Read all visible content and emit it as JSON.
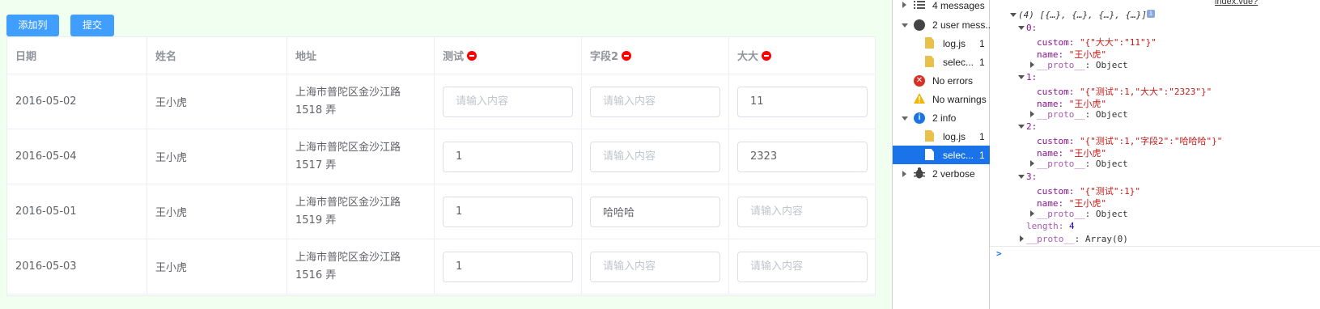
{
  "toolbar": {
    "add_column_label": "添加列",
    "submit_label": "提交"
  },
  "table": {
    "headers": {
      "date": "日期",
      "name": "姓名",
      "address": "地址",
      "col1": "测试",
      "col2": "字段2",
      "col3": "大大"
    },
    "placeholder": "请输入内容",
    "rows": [
      {
        "date": "2016-05-02",
        "name": "王小虎",
        "address": "上海市普陀区金沙江路 1518 弄",
        "col1": "",
        "col2": "",
        "col3": "11"
      },
      {
        "date": "2016-05-04",
        "name": "王小虎",
        "address": "上海市普陀区金沙江路 1517 弄",
        "col1": "1",
        "col2": "",
        "col3": "2323"
      },
      {
        "date": "2016-05-01",
        "name": "王小虎",
        "address": "上海市普陀区金沙江路 1519 弄",
        "col1": "1",
        "col2": "哈哈哈",
        "col3": ""
      },
      {
        "date": "2016-05-03",
        "name": "王小虎",
        "address": "上海市普陀区金沙江路 1516 弄",
        "col1": "1",
        "col2": "",
        "col3": ""
      }
    ]
  },
  "console_sidebar": {
    "items": [
      {
        "label": "4 messages",
        "count": ""
      },
      {
        "label": "2 user mess...",
        "count": ""
      },
      {
        "label": "log.js",
        "count": "1"
      },
      {
        "label": "selec...",
        "count": "1"
      },
      {
        "label": "No errors",
        "count": ""
      },
      {
        "label": "No warnings",
        "count": ""
      },
      {
        "label": "2 info",
        "count": ""
      },
      {
        "label": "log.js",
        "count": "1"
      },
      {
        "label": "selec...",
        "count": "1"
      },
      {
        "label": "2 verbose",
        "count": ""
      }
    ]
  },
  "console": {
    "source_link": "index.vue?",
    "array_summary": "(4) [{…}, {…}, {…}, {…}]",
    "entries": [
      {
        "index": "0:",
        "custom": "\"{\"大大\":\"11\"}\"",
        "name": "\"王小虎\""
      },
      {
        "index": "1:",
        "custom": "\"{\"测试\":1,\"大大\":\"2323\"}\"",
        "name": "\"王小虎\""
      },
      {
        "index": "2:",
        "custom": "\"{\"测试\":1,\"字段2\":\"哈哈哈\"}\"",
        "name": "\"王小虎\""
      },
      {
        "index": "3:",
        "custom": "\"{\"测试\":1}\"",
        "name": "\"王小虎\""
      }
    ],
    "custom_key": "custom:",
    "name_key": "name:",
    "proto_key": "__proto__",
    "proto_object": ": Object",
    "length_key": "length:",
    "length_value": "4",
    "array_proto": ": Array(0)",
    "prompt": ">"
  },
  "colors": {
    "primary": "#409eff",
    "delete": "#ff0000",
    "selected": "#1a73e8"
  }
}
